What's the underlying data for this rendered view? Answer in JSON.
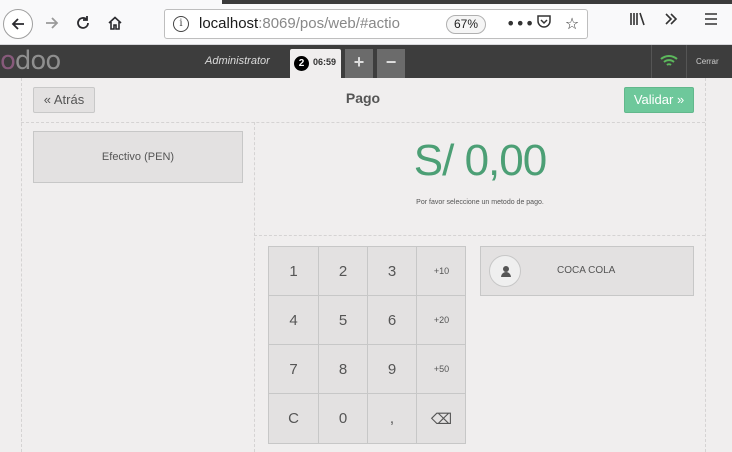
{
  "browser": {
    "url_host": "localhost",
    "url_rest": ":8069/pos/web/#actio",
    "zoom": "67%",
    "icons": [
      "back-icon",
      "forward-icon",
      "reload-icon",
      "home-icon",
      "info-icon",
      "more-icon",
      "pocket-icon",
      "star-icon",
      "library-icon",
      "overflow-icon",
      "menu-icon"
    ]
  },
  "topbar": {
    "logo": "odoo",
    "user": "Administrator",
    "order_number": "2",
    "order_time": "06:59",
    "new_order": "+",
    "delete_order": "−",
    "close_label": "Cerrar",
    "connection_color": "#5cb85c"
  },
  "payment": {
    "back_label": "« Atrás",
    "title": "Pago",
    "validate_label": "Validar »",
    "method": "Efectivo (PEN)",
    "amount": "S/ 0,00",
    "hint": "Por favor seleccione un metodo de pago.",
    "client_name": "COCA COLA",
    "accent_color": "#4c9f75",
    "validate_color": "#6ec89b"
  },
  "numpad": {
    "k1": "1",
    "k2": "2",
    "k3": "3",
    "k4": "+10",
    "k5": "4",
    "k6": "5",
    "k7": "6",
    "k8": "+20",
    "k9": "7",
    "k10": "8",
    "k11": "9",
    "k12": "+50",
    "k13": "C",
    "k14": "0",
    "k15": ",",
    "k16": "⌫"
  }
}
